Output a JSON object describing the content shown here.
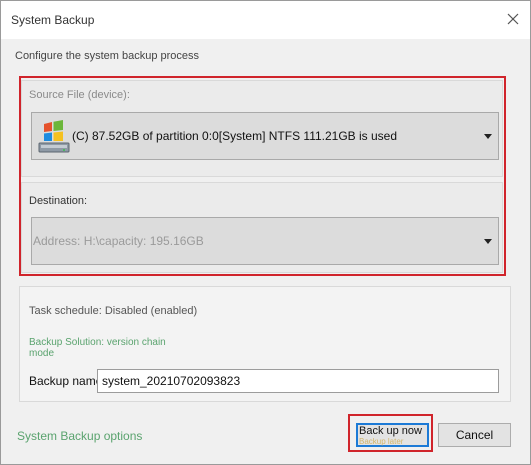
{
  "window": {
    "title": "System Backup"
  },
  "subtitle": "Configure the system backup process",
  "source": {
    "label": "Source File (device):",
    "value": "(C) 87.52GB of partition 0:0[System] NTFS 111.21GB is used",
    "icon": "windows-drive-icon"
  },
  "destination": {
    "label": "Destination:",
    "value": "Address: H:\\capacity: 195.16GB"
  },
  "task": {
    "schedule": "Task schedule: Disabled (enabled)",
    "solution": "Backup Solution: version chain mode",
    "name_label": "Backup name:",
    "name_value": "system_20210702093823"
  },
  "footer": {
    "options_link": "System Backup options",
    "backup_button": "Back up now",
    "backup_button_sub": "Backup later",
    "cancel_button": "Cancel"
  },
  "colors": {
    "highlight_border": "#d0242b",
    "link_green": "#5aa36e",
    "focus_blue": "#1c7ad6"
  }
}
